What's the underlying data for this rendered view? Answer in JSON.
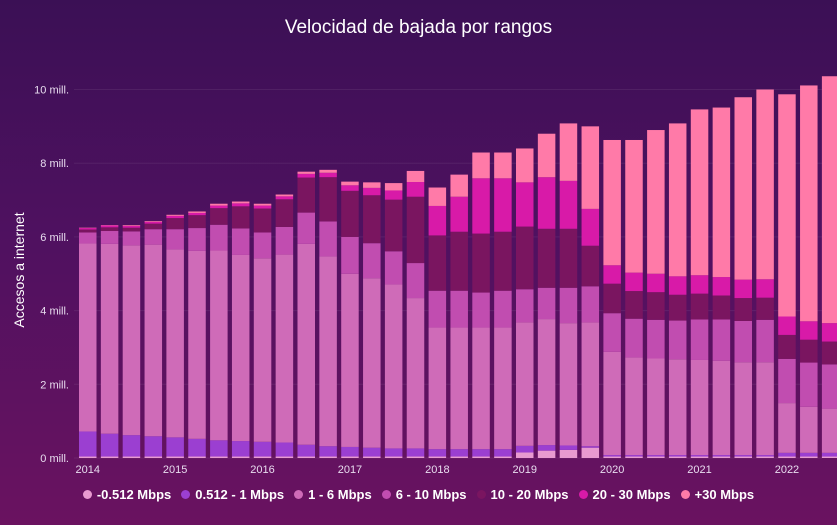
{
  "chart_data": {
    "type": "bar",
    "stacked": true,
    "title": "Velocidad de bajada por rangos",
    "ylabel": "Accesos a internet",
    "xlabel": "",
    "ylim": [
      0,
      10.8
    ],
    "yticks": [
      {
        "value": 0,
        "label": "0 mill."
      },
      {
        "value": 2,
        "label": "2 mill."
      },
      {
        "value": 4,
        "label": "4 mill."
      },
      {
        "value": 6,
        "label": "6 mill."
      },
      {
        "value": 8,
        "label": "8 mill."
      },
      {
        "value": 10,
        "label": "10 mill."
      }
    ],
    "xticks": [
      {
        "index": 0,
        "label": "2014"
      },
      {
        "index": 4,
        "label": "2015"
      },
      {
        "index": 8,
        "label": "2016"
      },
      {
        "index": 12,
        "label": "2017"
      },
      {
        "index": 16,
        "label": "2018"
      },
      {
        "index": 20,
        "label": "2019"
      },
      {
        "index": 24,
        "label": "2020"
      },
      {
        "index": 28,
        "label": "2021"
      },
      {
        "index": 32,
        "label": "2022"
      }
    ],
    "categories": [
      "2014-Q1",
      "2014-Q2",
      "2014-Q3",
      "2014-Q4",
      "2015-Q1",
      "2015-Q2",
      "2015-Q3",
      "2015-Q4",
      "2016-Q1",
      "2016-Q2",
      "2016-Q3",
      "2016-Q4",
      "2017-Q1",
      "2017-Q2",
      "2017-Q3",
      "2017-Q4",
      "2018-Q1",
      "2018-Q2",
      "2018-Q3",
      "2018-Q4",
      "2019-Q1",
      "2019-Q2",
      "2019-Q3",
      "2019-Q4",
      "2020-Q1",
      "2020-Q2",
      "2020-Q3",
      "2020-Q4",
      "2021-Q1",
      "2021-Q2",
      "2021-Q3",
      "2021-Q4",
      "2022-Q1",
      "2022-Q2",
      "2022-Q3"
    ],
    "series": [
      {
        "name": "-0.512 Mbps",
        "color": "#e89ad0",
        "values": [
          0.04,
          0.04,
          0.04,
          0.04,
          0.04,
          0.04,
          0.04,
          0.04,
          0.04,
          0.04,
          0.04,
          0.04,
          0.04,
          0.04,
          0.04,
          0.04,
          0.04,
          0.04,
          0.04,
          0.04,
          0.15,
          0.2,
          0.22,
          0.28,
          0.04,
          0.04,
          0.04,
          0.04,
          0.04,
          0.04,
          0.04,
          0.04,
          0.04,
          0.04,
          0.04
        ]
      },
      {
        "name": "0.512 - 1 Mbps",
        "color": "#9b3fd1",
        "values": [
          0.68,
          0.62,
          0.58,
          0.55,
          0.52,
          0.48,
          0.44,
          0.42,
          0.4,
          0.38,
          0.32,
          0.28,
          0.26,
          0.24,
          0.22,
          0.22,
          0.2,
          0.2,
          0.2,
          0.2,
          0.18,
          0.15,
          0.12,
          0.04,
          0.04,
          0.04,
          0.04,
          0.04,
          0.04,
          0.04,
          0.04,
          0.04,
          0.1,
          0.1,
          0.1
        ]
      },
      {
        "name": "1 - 6 Mbps",
        "color": "#cf6bb8",
        "values": [
          5.1,
          5.15,
          5.15,
          5.2,
          5.1,
          5.1,
          5.15,
          5.05,
          4.98,
          5.1,
          5.45,
          5.15,
          4.7,
          4.6,
          4.45,
          4.08,
          3.3,
          3.3,
          3.3,
          3.3,
          3.35,
          3.42,
          3.32,
          3.36,
          2.8,
          2.65,
          2.62,
          2.6,
          2.58,
          2.56,
          2.52,
          2.52,
          1.35,
          1.25,
          1.2
        ]
      },
      {
        "name": "6 - 10 Mbps",
        "color": "#c14db0",
        "values": [
          0.3,
          0.35,
          0.38,
          0.42,
          0.55,
          0.62,
          0.7,
          0.72,
          0.7,
          0.75,
          0.85,
          0.95,
          1.0,
          0.95,
          0.9,
          0.95,
          1.0,
          1.0,
          0.95,
          1.0,
          0.9,
          0.85,
          0.96,
          0.98,
          1.05,
          1.05,
          1.05,
          1.05,
          1.1,
          1.12,
          1.12,
          1.15,
          1.2,
          1.2,
          1.2
        ]
      },
      {
        "name": "10 - 20 Mbps",
        "color": "#7a1560",
        "values": [
          0.08,
          0.1,
          0.1,
          0.15,
          0.3,
          0.35,
          0.45,
          0.6,
          0.65,
          0.75,
          0.95,
          1.2,
          1.25,
          1.3,
          1.4,
          1.8,
          1.5,
          1.6,
          1.6,
          1.6,
          1.7,
          1.6,
          1.6,
          1.1,
          0.8,
          0.75,
          0.75,
          0.7,
          0.7,
          0.65,
          0.62,
          0.6,
          0.65,
          0.62,
          0.62
        ]
      },
      {
        "name": "20 - 30 Mbps",
        "color": "#d81aa8",
        "values": [
          0.04,
          0.05,
          0.05,
          0.05,
          0.06,
          0.06,
          0.07,
          0.08,
          0.08,
          0.08,
          0.1,
          0.12,
          0.15,
          0.2,
          0.25,
          0.4,
          0.8,
          0.95,
          1.5,
          1.45,
          1.2,
          1.4,
          1.3,
          1.0,
          0.5,
          0.5,
          0.5,
          0.5,
          0.5,
          0.5,
          0.5,
          0.5,
          0.5,
          0.5,
          0.5
        ]
      },
      {
        "name": "+30 Mbps",
        "color": "#ff7aa8",
        "values": [
          0.01,
          0.01,
          0.02,
          0.02,
          0.03,
          0.04,
          0.05,
          0.05,
          0.05,
          0.05,
          0.06,
          0.08,
          0.1,
          0.15,
          0.2,
          0.3,
          0.5,
          0.6,
          0.7,
          0.7,
          0.92,
          1.18,
          1.56,
          2.24,
          3.4,
          3.6,
          3.9,
          4.15,
          4.5,
          4.6,
          4.95,
          5.15,
          6.03,
          6.4,
          6.7
        ]
      }
    ]
  }
}
